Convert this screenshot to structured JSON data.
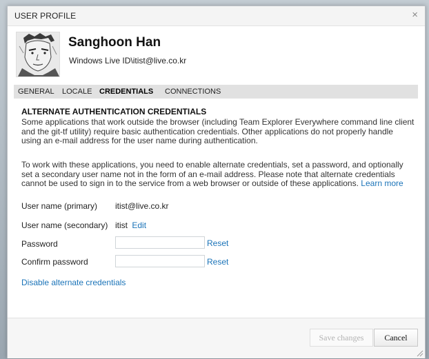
{
  "dialog": {
    "title": "USER PROFILE",
    "close_glyph": "×"
  },
  "profile": {
    "name": "Sanghoon Han",
    "account": "Windows Live ID\\itist@live.co.kr"
  },
  "tabs": [
    {
      "label": "GENERAL",
      "active": false
    },
    {
      "label": "LOCALE",
      "active": false
    },
    {
      "label": "CREDENTIALS",
      "active": true
    },
    {
      "label": "CONNECTIONS",
      "active": false
    }
  ],
  "credentials": {
    "heading": "ALTERNATE AUTHENTICATION CREDENTIALS",
    "para1": "Some applications that work outside the browser (including Team Explorer Everywhere command line client and the git-tf utility) require basic authentication credentials. Other applications do not properly handle using an e-mail address for the user name during authentication.",
    "para2": "To work with these applications, you need to enable alternate credentials, set a password, and optionally set a secondary user name not in the form of an e-mail address. Please note that alternate credentials cannot be used to sign in to the service from a web browser or outside of these applications.",
    "learn_more": "Learn more",
    "primary_label": "User name (primary)",
    "primary_value": "itist@live.co.kr",
    "secondary_label": "User name (secondary)",
    "secondary_value": "itist",
    "edit_label": "Edit",
    "password_label": "Password",
    "password_value": "",
    "confirm_label": "Confirm password",
    "confirm_value": "",
    "reset_label": "Reset",
    "disable_link": "Disable alternate credentials"
  },
  "footer": {
    "save_label": "Save changes",
    "cancel_label": "Cancel"
  },
  "colors": {
    "link": "#1a73b8",
    "tab_bar": "#e1e1e1"
  }
}
